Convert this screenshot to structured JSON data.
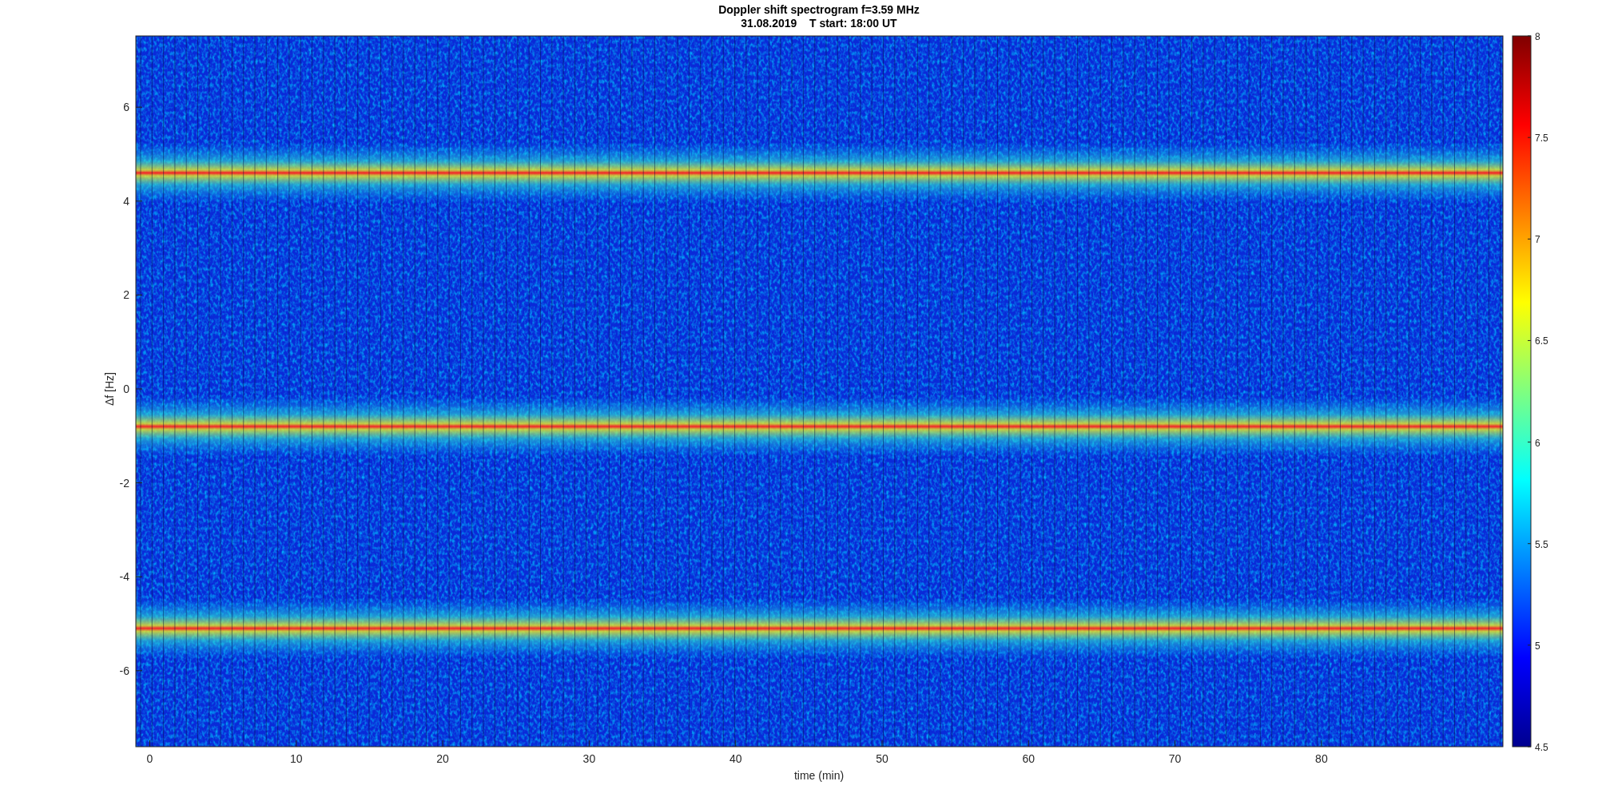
{
  "figure": {
    "title_lines": [
      "Doppler shift spectrogram f=3.59 MHz",
      "31.08.2019    T start: 18:00 UT"
    ]
  },
  "axes": {
    "xlabel": "time (min)",
    "ylabel": "Δf [Hz]",
    "xticks": [
      "0",
      "10",
      "20",
      "30",
      "40",
      "50",
      "60",
      "70",
      "80"
    ],
    "yticks": [
      "6",
      "4",
      "2",
      "0",
      "-2",
      "-4",
      "-6"
    ]
  },
  "colorbar": {
    "ticks": [
      "8",
      "7.5",
      "7",
      "6.5",
      "6",
      "5.5",
      "5",
      "4.5"
    ]
  }
}
